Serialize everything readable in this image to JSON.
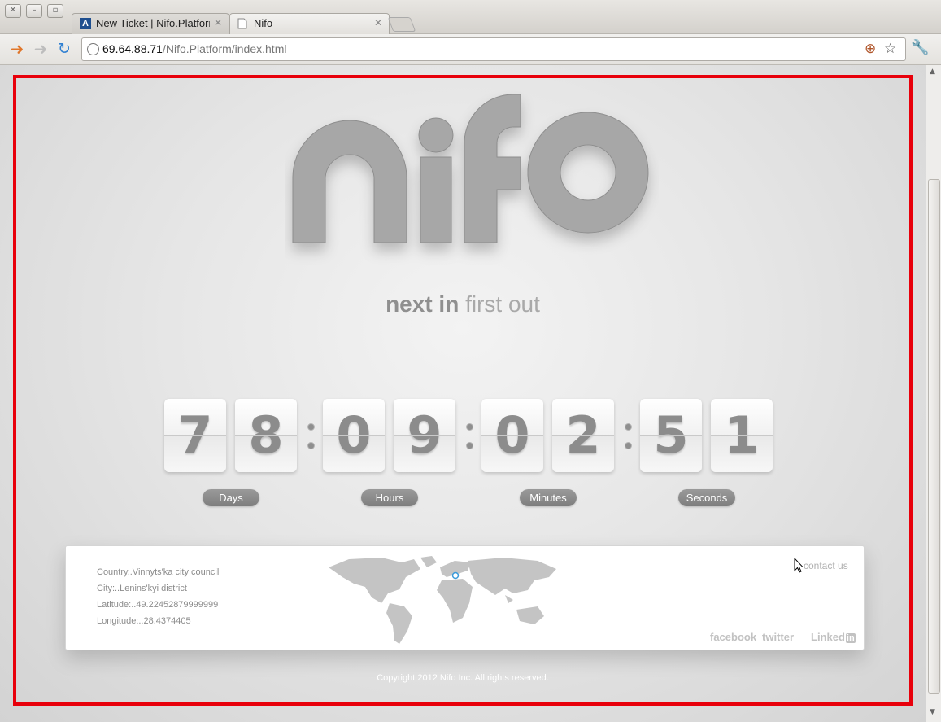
{
  "window": {
    "controls": [
      "close",
      "minimize",
      "maximize"
    ]
  },
  "tabs": [
    {
      "title": "New Ticket | Nifo.Platform",
      "favicon": "A",
      "active": false
    },
    {
      "title": "Nifo",
      "favicon": "page-icon",
      "active": true
    }
  ],
  "address": {
    "host": "69.64.88.71",
    "path": "/Nifo.Platform/index.html"
  },
  "logo": {
    "text": "nifo"
  },
  "tagline": {
    "bold": "next in",
    "light": "first out"
  },
  "countdown": {
    "digits": [
      "7",
      "8",
      "0",
      "9",
      "0",
      "2",
      "5",
      "1"
    ],
    "labels": [
      "Days",
      "Hours",
      "Minutes",
      "Seconds"
    ]
  },
  "location": {
    "country": "Country..Vinnyts'ka city council",
    "city": "City:..Lenins'kyi district",
    "latitude": "Latitude:..49.22452879999999",
    "longitude": "Longitude:..28.4374405"
  },
  "contact_label": "contact us",
  "social": {
    "facebook": "facebook",
    "twitter": "twitter",
    "linkedin": "Linked",
    "linkedin_badge": "in"
  },
  "copyright": "Copyright 2012 Nifo Inc. All rights reserved.",
  "colors": {
    "frame": "#e8000b",
    "logo": "#a7a7a7",
    "accent": "#3a9ad9"
  }
}
